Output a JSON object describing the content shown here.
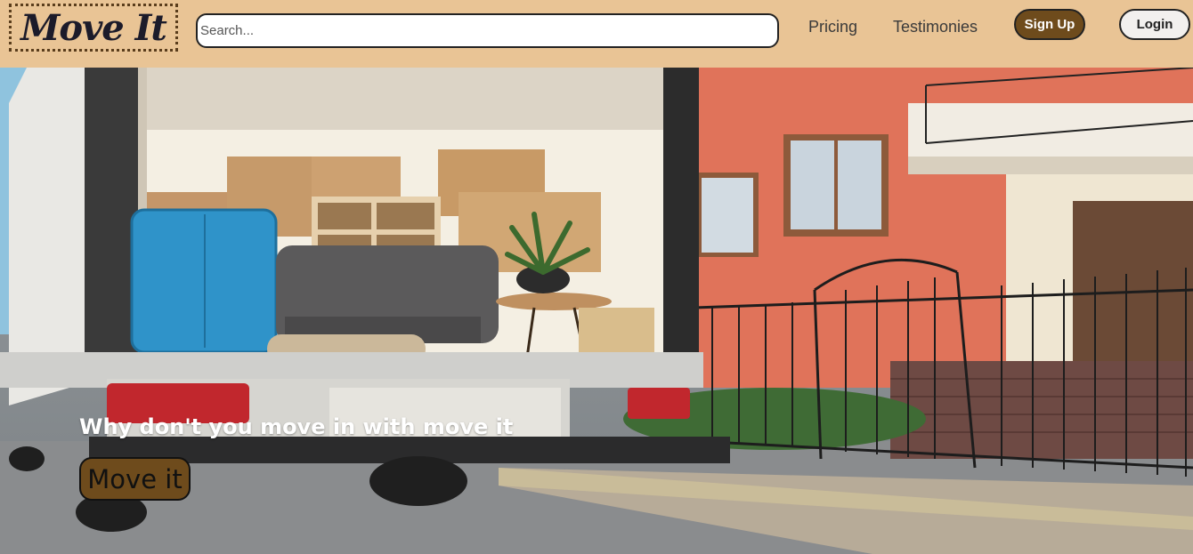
{
  "header": {
    "logo_text": "Move It",
    "search_placeholder": "Search...",
    "nav": {
      "pricing": "Pricing",
      "testimonies": "Testimonies"
    },
    "signup_label": "Sign Up",
    "login_label": "Login"
  },
  "hero": {
    "headline": "Why don't you move in with move it",
    "cta_label": "Move it",
    "image_semantic": "moving-truck-with-boxes-near-brick-house"
  },
  "colors": {
    "header_bg": "#e9c495",
    "brand_brown": "#6e4b1c",
    "login_bg": "#f2f0ee"
  }
}
